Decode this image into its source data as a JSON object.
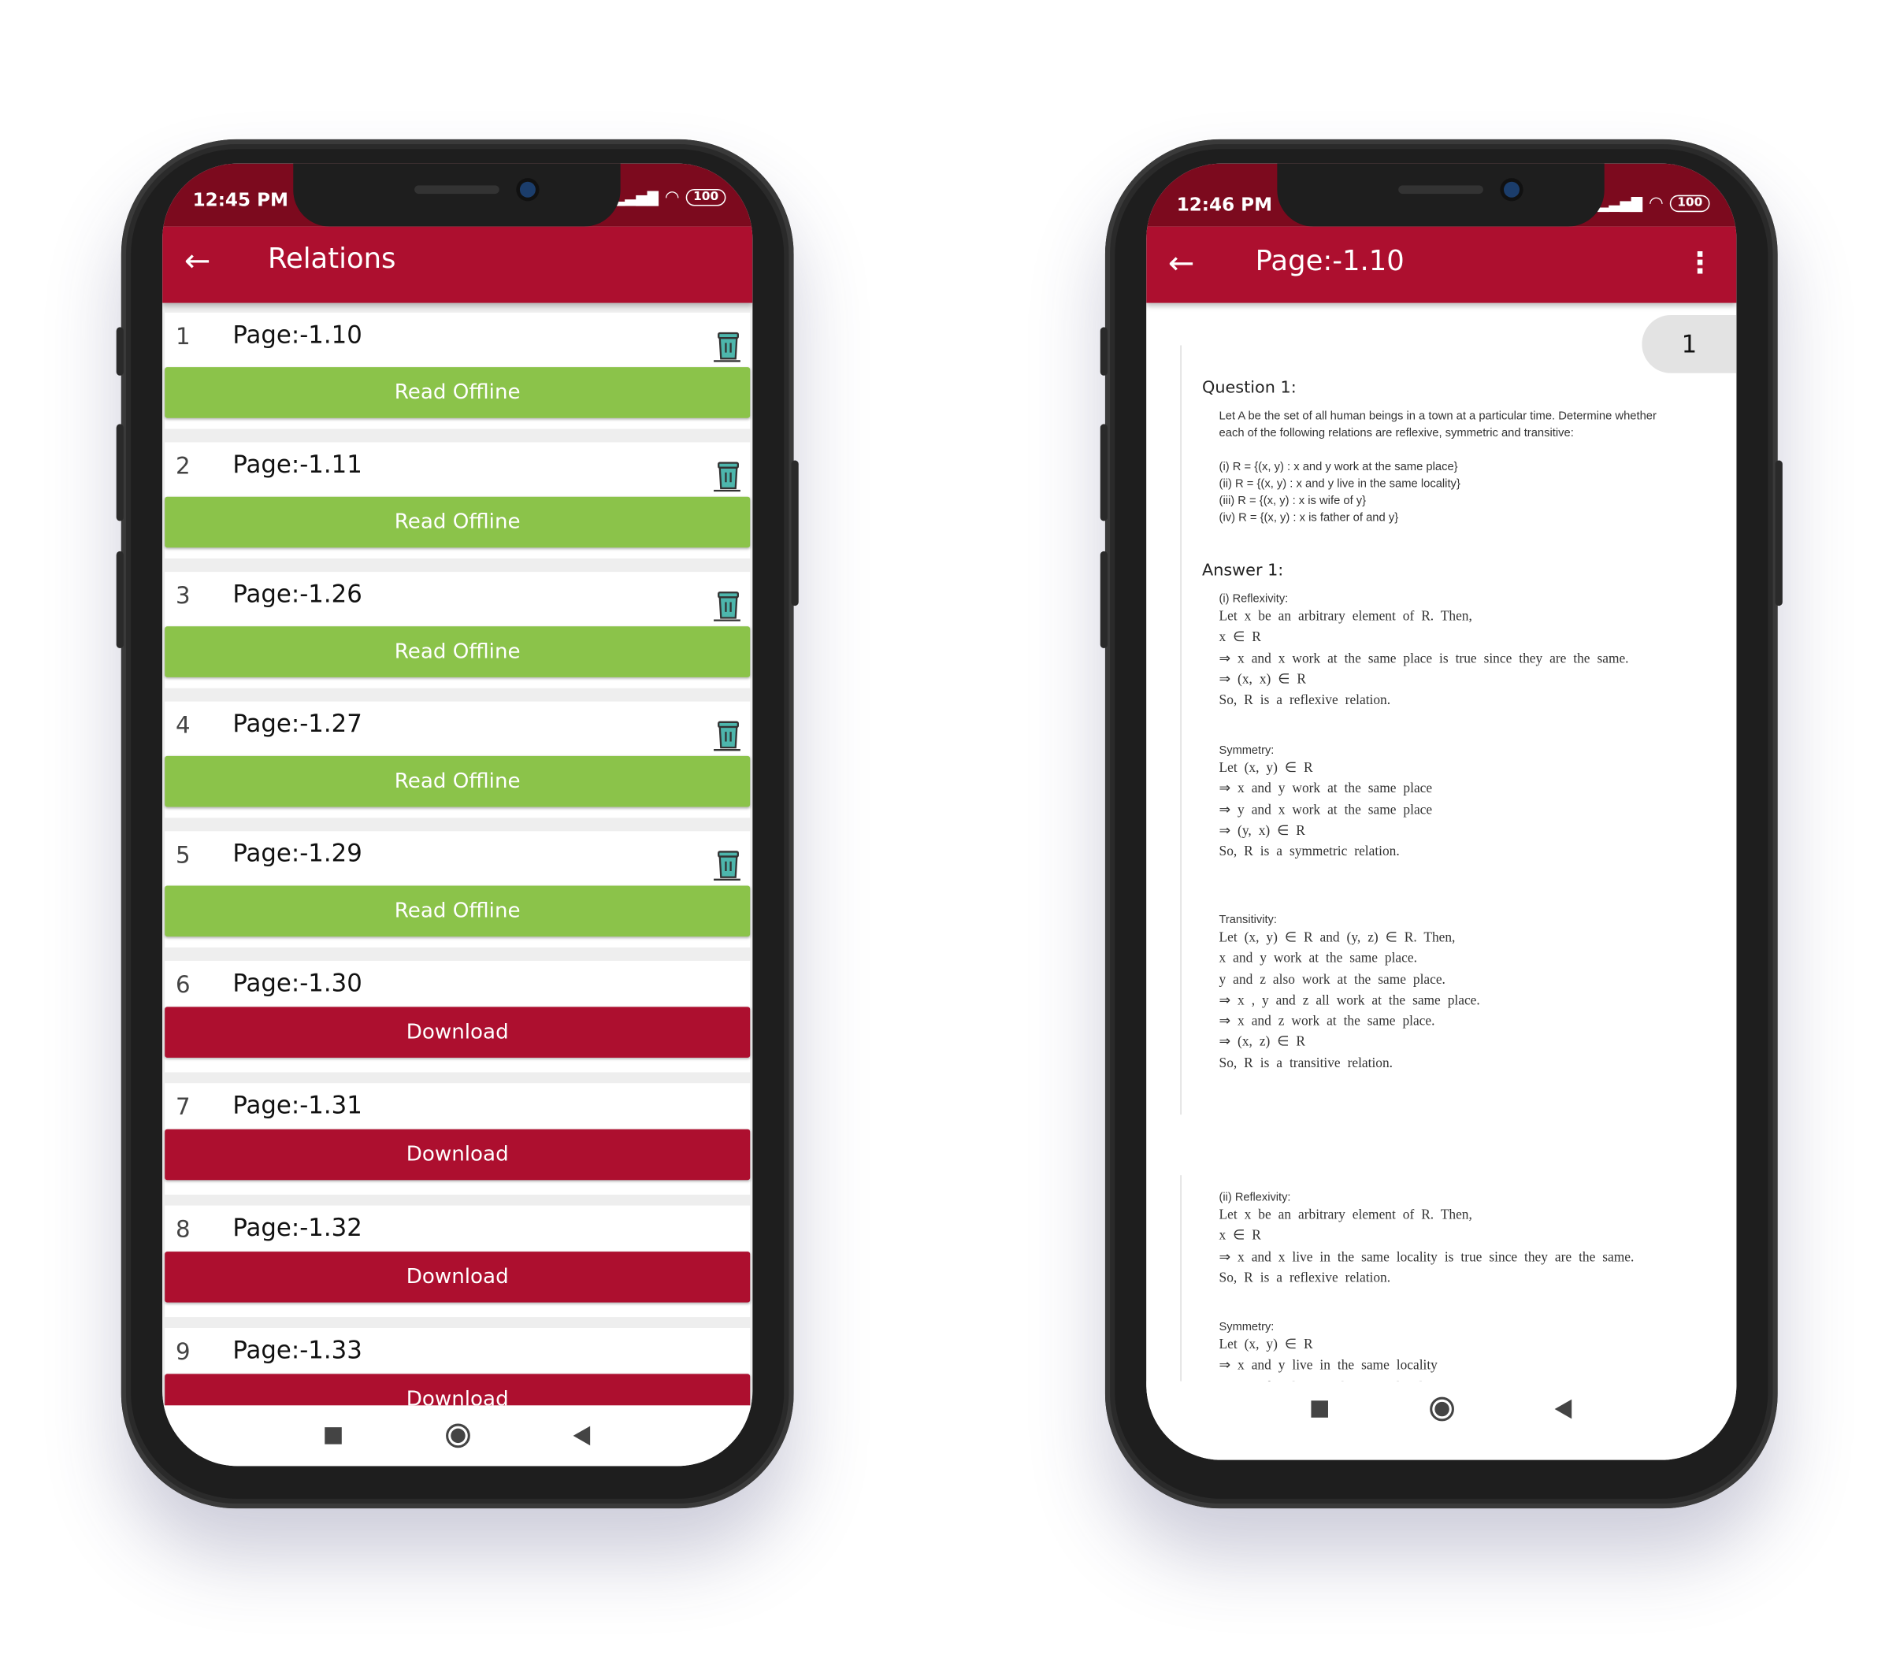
{
  "colors": {
    "primary": "#ad0f2f",
    "status_bar": "#7c0a1e",
    "read_offline": "#8bc34a",
    "download": "#ad0f2f",
    "trash": "#4db6ac"
  },
  "left_phone": {
    "status": {
      "time": "12:45 PM",
      "battery": "100"
    },
    "appbar": {
      "back_icon": "←",
      "title": "Relations"
    },
    "items": [
      {
        "num": "1",
        "title": "Page:-1.10",
        "action": "Read Offline",
        "state": "downloaded"
      },
      {
        "num": "2",
        "title": "Page:-1.11",
        "action": "Read Offline",
        "state": "downloaded"
      },
      {
        "num": "3",
        "title": "Page:-1.26",
        "action": "Read Offline",
        "state": "downloaded"
      },
      {
        "num": "4",
        "title": "Page:-1.27",
        "action": "Read Offline",
        "state": "downloaded"
      },
      {
        "num": "5",
        "title": "Page:-1.29",
        "action": "Read Offline",
        "state": "downloaded"
      },
      {
        "num": "6",
        "title": "Page:-1.30",
        "action": "Download",
        "state": "remote"
      },
      {
        "num": "7",
        "title": "Page:-1.31",
        "action": "Download",
        "state": "remote"
      },
      {
        "num": "8",
        "title": "Page:-1.32",
        "action": "Download",
        "state": "remote"
      },
      {
        "num": "9",
        "title": "Page:-1.33",
        "action": "Download",
        "state": "remote"
      }
    ]
  },
  "right_phone": {
    "status": {
      "time": "12:46 PM",
      "battery": "100"
    },
    "appbar": {
      "back_icon": "←",
      "title": "Page:-1.10",
      "menu_icon": "⋮"
    },
    "page_number": "1",
    "document": {
      "question_heading": "Question 1:",
      "question_text": [
        "Let A be the set of all human beings in a town at a particular time. Determine whether",
        "each of the following relations are reflexive, symmetric and transitive:"
      ],
      "relations": [
        "(i) R = {(x, y) : x and y work at the same place}",
        "(ii) R = {(x, y) : x and y live in the same locality}",
        "(iii) R = {(x, y) : x is wife of y}",
        "(iv) R = {(x, y) : x is father of and y}"
      ],
      "answer_heading": "Answer 1:",
      "sections": [
        {
          "label": "(i) Reflexivity:",
          "lines": [
            "Let x be an arbitrary element of R. Then,",
            "x ∈ R",
            "⇒ x and x work at the same place is true since they are the same.",
            "⇒ (x, x) ∈ R",
            "So, R is a reflexive relation."
          ]
        },
        {
          "label": "Symmetry:",
          "lines": [
            "Let (x, y) ∈ R",
            "⇒ x and y work at the same place",
            "⇒ y and x work at the same place",
            "⇒ (y, x) ∈ R",
            "So, R is a symmetric relation."
          ]
        },
        {
          "label": "Transitivity:",
          "lines": [
            "Let (x, y) ∈ R and (y, z) ∈ R. Then,",
            "x and y work at the same place.",
            "y and z also work at the same place.",
            "⇒ x , y and z all work at the same place.",
            "⇒ x and z work at the same place.",
            "⇒ (x, z) ∈ R",
            "So, R is a transitive relation."
          ]
        },
        {
          "label": "(ii) Reflexivity:",
          "lines": [
            "Let x be an arbitrary element of R. Then,",
            "x ∈ R",
            "⇒ x and x live in the same locality is true since they are the same.",
            "So, R is a reflexive relation."
          ]
        },
        {
          "label": "Symmetry:",
          "lines": [
            "Let (x, y) ∈ R",
            "⇒ x and y live in the same locality",
            "⇒ y and x live in the same locality"
          ]
        }
      ]
    }
  }
}
